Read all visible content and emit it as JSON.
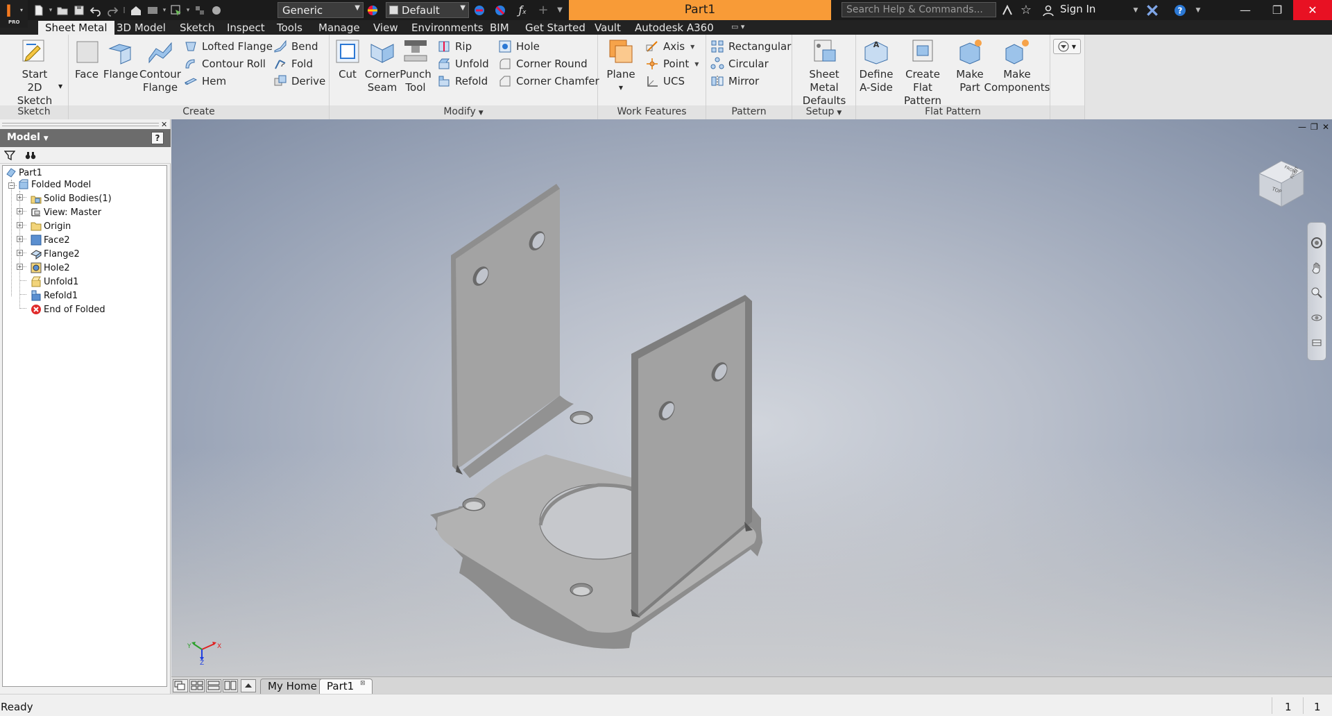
{
  "app": {
    "logo_edition": "PRO"
  },
  "toolbar": {
    "material": "Generic",
    "appearance": "Default"
  },
  "document": {
    "title": "Part1"
  },
  "help_search": {
    "placeholder": "Search Help & Commands..."
  },
  "user": {
    "sign_in": "Sign In"
  },
  "ribbon_tabs": [
    "Sheet Metal",
    "3D Model",
    "Sketch",
    "Inspect",
    "Tools",
    "Manage",
    "View",
    "Environments",
    "BIM",
    "Get Started",
    "Vault",
    "Autodesk A360"
  ],
  "ribbon": {
    "sketch": {
      "title": "Sketch",
      "start_sketch_line1": "Start",
      "start_sketch_line2": "2D Sketch"
    },
    "create": {
      "title": "Create",
      "face": "Face",
      "flange": "Flange",
      "contour_flange_line1": "Contour",
      "contour_flange_line2": "Flange",
      "lofted_flange": "Lofted Flange",
      "contour_roll": "Contour Roll",
      "hem": "Hem",
      "bend": "Bend",
      "fold": "Fold",
      "derive": "Derive"
    },
    "modify": {
      "title": "Modify",
      "cut": "Cut",
      "corner_seam_line1": "Corner",
      "corner_seam_line2": "Seam",
      "punch_tool_line1": "Punch",
      "punch_tool_line2": "Tool",
      "rip": "Rip",
      "unfold": "Unfold",
      "refold": "Refold",
      "hole": "Hole",
      "corner_round": "Corner Round",
      "corner_chamfer": "Corner Chamfer"
    },
    "work_features": {
      "title": "Work Features",
      "plane": "Plane",
      "axis": "Axis",
      "point": "Point",
      "ucs": "UCS"
    },
    "pattern": {
      "title": "Pattern",
      "rectangular": "Rectangular",
      "circular": "Circular",
      "mirror": "Mirror"
    },
    "setup": {
      "title": "Setup",
      "defaults_line1": "Sheet Metal",
      "defaults_line2": "Defaults"
    },
    "flat_pattern": {
      "title": "Flat Pattern",
      "define_a_side_line1": "Define",
      "define_a_side_line2": "A-Side",
      "create_flat_line1": "Create",
      "create_flat_line2": "Flat Pattern",
      "make_part_line1": "Make",
      "make_part_line2": "Part",
      "make_components_line1": "Make",
      "make_components_line2": "Components"
    }
  },
  "browser": {
    "title": "Model",
    "tree": [
      {
        "label": "Part1",
        "icon": "part-icon"
      },
      {
        "label": "Folded Model",
        "icon": "folded-model-icon"
      },
      {
        "label": "Solid Bodies(1)",
        "icon": "solid-bodies-icon"
      },
      {
        "label": "View: Master",
        "icon": "view-icon"
      },
      {
        "label": "Origin",
        "icon": "folder-icon"
      },
      {
        "label": "Face2",
        "icon": "face-feature-icon"
      },
      {
        "label": "Flange2",
        "icon": "flange-feature-icon"
      },
      {
        "label": "Hole2",
        "icon": "hole-feature-icon"
      },
      {
        "label": "Unfold1",
        "icon": "unfold-feature-icon"
      },
      {
        "label": "Refold1",
        "icon": "refold-feature-icon"
      },
      {
        "label": "End of Folded",
        "icon": "end-of-part-icon"
      }
    ]
  },
  "viewcube": {
    "faces": [
      "TOP",
      "RIGHT",
      "FRONT"
    ]
  },
  "triad": {
    "x": "X",
    "y": "Y",
    "z": "Z"
  },
  "doc_tabs": {
    "home": "My Home",
    "part": "Part1"
  },
  "status": {
    "text": "Ready",
    "count1": "1",
    "count2": "1"
  },
  "colors": {
    "accent_orange": "#f89b37",
    "close_red": "#e81123",
    "model_face": "#a2a2a2"
  }
}
